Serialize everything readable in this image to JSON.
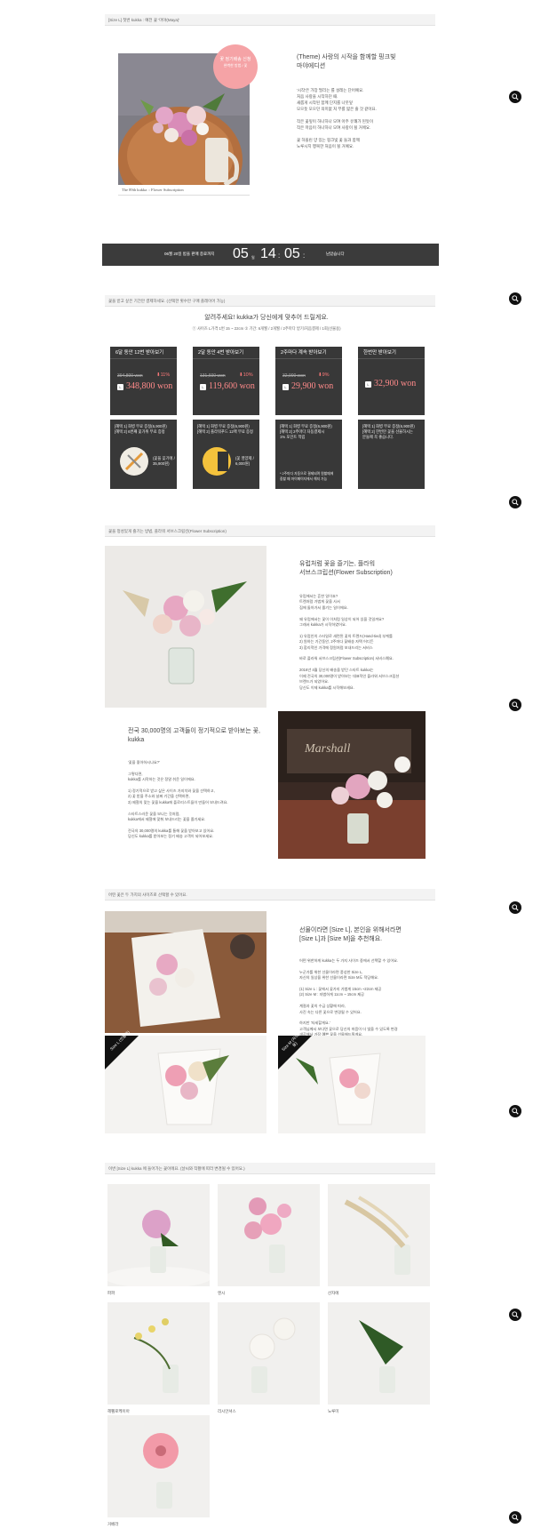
{
  "colors": {
    "accent": "#f28c8c",
    "dark": "#383838",
    "countdown_bg": "#3b3b3b"
  },
  "bars": {
    "s1": "[Size L] 첫번 kukka : 예전 꽃 '마야(Maya)'",
    "s2": "꽃을 받고 싶은 기간만 결제하세요. (선택한 횟수만 구매 플레이어 가능)",
    "s3": "꽃을 정성있게 즐기는 방법, 플라워 서브스크립션(Flower Subscription)",
    "s4": "어떤 꽃은 두 가지의 사이즈로 선택할 수 있어요.",
    "s5": "이번 [Size L] kukka 에 들어가는 꽃이에요. (날씨와 작황에 따라 변경될 수 있어요.)"
  },
  "hero": {
    "circle_title": "꽃 정기배송 신청",
    "circle_sub": "완벽한 방법 / 꽃",
    "caption": "The 89th kukka :: Flower Subscription",
    "title_1": "(Theme) 사랑의 시작을 함께할 핑크빛",
    "title_2": "마야에디션",
    "lines": [
      "'시작'은 가장 떨리는 를 설레는 단어예요.",
      "처음 사랑을 시작하던 때.",
      "새롭게 시작된 함께 단지를 나뭇잎",
      "모으듯 모으던 의미없 처 부를 얇은 줄 것 같아요.",
      "",
      "작은 꽃잎이 하나하나 모여 아주 유쾌가 된듯이",
      "작은 마음이 하나하나 모여 사랑이 될 거에요.",
      "",
      "꽃 하올린 양 있는 핑크빛 꽃 들과 함께",
      "노루시지 행복한 처음이 될 거예요."
    ]
  },
  "countdown": {
    "label": "06월 20일 밤을 판매 종료까지",
    "days": "05",
    "days_unit": "일",
    "hours": "14",
    "hours_unit": ":",
    "mins": "05",
    "mins_unit": ":",
    "secs_label": "남았습니다"
  },
  "pricing": {
    "intro": "알려주세요! kukka가 당신에게 맞추어 드릴게요.",
    "sub": "① 사이즈 L가격 1번 15 ~ 22cm ② 기간: 6개월 / 2개월 / 2주마다 받기/처음결제 / 1회(선물용)",
    "cards": [
      {
        "top": "6달 동안 12번 받아보기",
        "old": "394,800 won",
        "pct": "11%",
        "price": "348,800 won"
      },
      {
        "top": "2달 동안 4번 받아보기",
        "old": "131,600 won",
        "pct": "10%",
        "price": "119,600 won"
      },
      {
        "top": "2주마다 계속 받아보기",
        "old": "32,900 won",
        "pct": "9%",
        "price": "29,900 won"
      },
      {
        "top": "한번만 받아보기",
        "old": "",
        "pct": "",
        "price": "32,900 won"
      }
    ],
    "label_L": "L",
    "benefits": [
      {
        "l1": "[혜택 1] 화병 무료 증정(6,900원)",
        "l2": "[혜택 2] 6번째 꽃가위 무료 증정",
        "caption": "(꽃을 꽂기에 /",
        "caption2": "35,900원)"
      },
      {
        "l1": "[혜택 1] 화병 무료 증정(6,900원)",
        "l2": "[혜택 2] 플라워푸드 12팩 무료 증정",
        "caption": "(꽃 영양제 /",
        "caption2": "6,000원)"
      },
      {
        "l1": "[혜택 1] 화병 무료 증정(6,900원)",
        "l2": "[혜택 2] 2주마다 자동결제시",
        "l3": "1% 포인트 적립",
        "note": "* 2주마다 자동으로 결제되며 원할때에",
        "note2": "중할 때 마이페이지에서 해지 가능"
      },
      {
        "l1": "[혜택 1] 화병 무료 증정(6,900원)",
        "l2": "[혜택 2] 한번만 꽃을 선물하시는",
        "l3": "분들께 꼭 좋습니다."
      }
    ]
  },
  "sub": {
    "h1_1": "유럽처럼 꽃을 즐기는, 플라워",
    "h1_2": "서브스크립션(Flower Subscription)",
    "lines1": [
      "유럽에서는 흔한 일이죠?",
      "트렌처럼 가볍게 꽃을 사서",
      "집에 돌아가서 즐기는 일이에요.",
      "",
      "왜 유럽에서는 꽃이 이처럼 일상이 되어 있을 것일까요?",
      "그래서 kukka가 시작하였어요.",
      "",
      "1) 유럽인의 스타일로 새련된 꽃의 트렌드(Hand-tied) 부케를",
      "2) 원하는 기간동안, 2주마다 꽃배송 자택 어디든",
      "3) 합리적인 가격에 정원처럼 보내드리는 서비스",
      "",
      "바로 플라워 서브스크립션(Flower Subscription) 서비스예요.",
      "",
      "2016년 4월 당신의 배송을 받던 스타트 kukka는",
      "이제 전국의 30,000명이 받아보는 대표적인 플라워 서브스크립션",
      "브랜드가 되었어요.",
      "당신도 이제 kukka를 시작해보세요."
    ],
    "h2_1": "전국 30,000명의 고객들이 정기적으로 받아보는 꽃,",
    "h2_2": "kukka",
    "lines2": [
      "'꽃을 좋아하시나요?'",
      "",
      "그렇다면,",
      "kukka를 시작하는 것은 정말 쉬운 일이에요.",
      "",
      "1) 정기적으로 받고 싶은 사이즈 가지치와 꽃을 선택하고,",
      "2) 꽃 받을 주소와 날짜 기간을 선택하면,",
      "3) 제철의 맞는 꽃을 kukka에 플로리스트들이 만들어 보내드려요.",
      "",
      "스타트스러운 꽃을 보나는 것처럼,",
      "kukka에서 제철에 맞춰 보내드리는 꽃을 즐기세요.",
      "",
      "전국의 30,000명의 kukka를 통해 꽃을 받아보고 있어요.",
      "당신도 kukka를 받아보는 정기 배송 고객이 되어보세요."
    ]
  },
  "size": {
    "h_1": "선물이라면 [Size L], 본인을 위해서라면",
    "h_2": "[Size L]과 [Size M]을 추천해요.",
    "lines": [
      "어떤 위한하게 kukka는 두 가지 사이즈 중에서 선택할 수 있어요.",
      "",
      "누군가를 위한 선물이라면 풍성한 Size L,",
      "자신의 일상을 위한 선물이라면 Size M도 적당해요.",
      "",
      "(1) Size L : 꽃에서 꽃가지 가볍게 15cm ~22cm 제공",
      "(2) Size M : 자볍하게 11cm ~ 15cm 제공",
      "",
      "계절과 꽃의 수급 상황에 따라,",
      "사진 속는 다른 꽃으로 변경될 수 있어요.",
      "",
      "하지만 '자세할게요.'",
      "고객님께서 보다면 꽃으로 당신의 마음이 더 빛을 수 있도록 변경",
      "제공해서 가장 예쁜 꽃을 선물해드릴게요."
    ],
    "badge_L": "Size L (선물용)",
    "badge_M": "Size M (자취생용)"
  },
  "gallery": [
    {
      "label": "파파"
    },
    {
      "label": "엔시"
    },
    {
      "label": "산자에"
    },
    {
      "label": "헤펠로케이아"
    },
    {
      "label": "리시안셔스"
    },
    {
      "label": "노루미"
    },
    {
      "label": "거베라"
    }
  ]
}
